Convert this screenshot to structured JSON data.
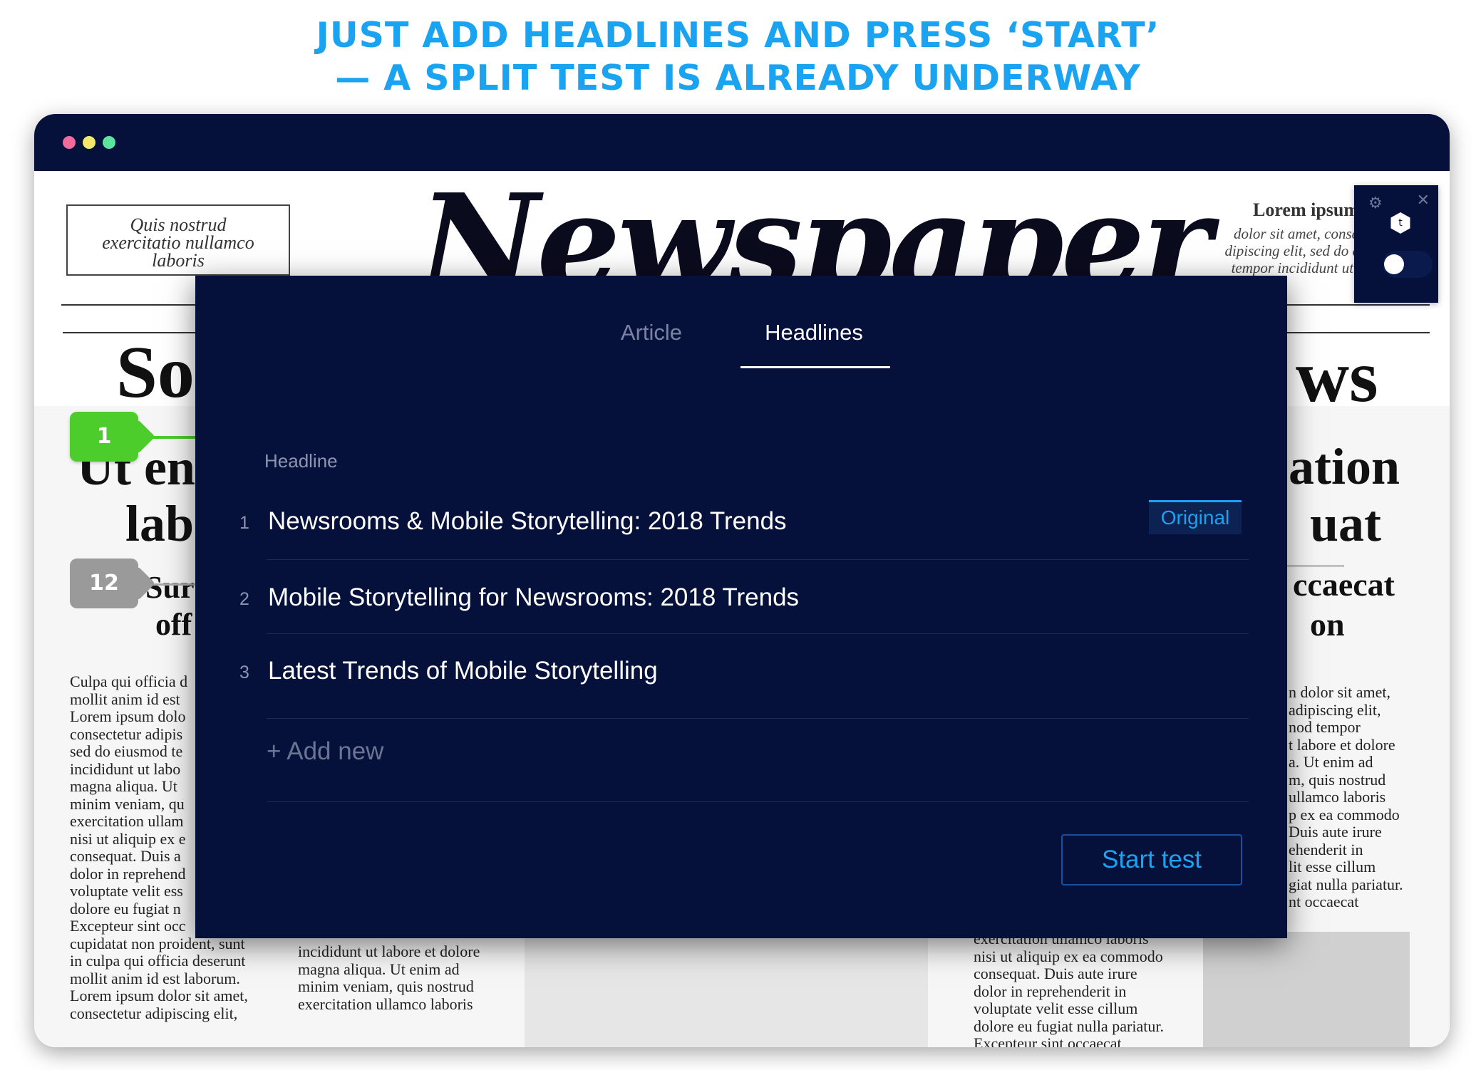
{
  "promo": {
    "line1": "JUST ADD HEADLINES AND PRESS ‘START’",
    "line2": "— A SPLIT TEST IS ALREADY UNDERWAY"
  },
  "window": {
    "controls": [
      "close",
      "minimize",
      "maximize"
    ]
  },
  "newspaper": {
    "masthead": "Newspaper",
    "ear_left": [
      "Quis nostrud",
      "exercitatio nullamco",
      "laboris"
    ],
    "ear_right_title": "Lorem ipsum",
    "ear_right_body": [
      "dolor sit amet, consectetur",
      "dipiscing elit, sed do eiusmod",
      "tempor incididunt ut labore"
    ],
    "headline_left_1": "So",
    "headline_right_1": "ws",
    "sub_left_1": "Ut en",
    "sub_left_2": "lab",
    "sub_right_1": "ation",
    "sub_right_2": "uat",
    "small_left_1": "Sur",
    "small_left_2": "off",
    "small_right_1": "ccaecat",
    "small_right_2": "on",
    "col_left": [
      "Culpa qui officia d",
      "mollit anim id est",
      "Lorem ipsum dolo",
      "consectetur adipis",
      "sed do eiusmod te",
      "incididunt ut labo",
      "magna aliqua. Ut",
      "minim veniam, qu",
      "exercitation ullam",
      "nisi ut aliquip ex e",
      "consequat. Duis a",
      "dolor in reprehend",
      "voluptate velit ess",
      "dolore eu fugiat n",
      "Excepteur sint occ",
      "cupidatat non proident, sunt",
      "in culpa qui officia deserunt",
      "mollit anim id est laborum.",
      "Lorem ipsum dolor sit amet,",
      "consectetur adipiscing elit,"
    ],
    "col_mid": [
      "incididunt ut labore et dolore",
      "magna aliqua. Ut enim ad",
      "minim veniam, quis nostrud",
      "exercitation ullamco laboris"
    ],
    "col_right": [
      "n dolor sit amet,",
      "adipiscing elit,",
      "nod tempor",
      "t labore et dolore",
      "a. Ut enim ad",
      "m, quis nostrud",
      "ullamco laboris",
      "p ex ea commodo",
      "Duis aute irure",
      "ehenderit in",
      "lit esse cillum",
      "giat nulla pariatur.",
      "nt occaecat"
    ],
    "col_right2": [
      "exercitation ullamco laboris",
      "nisi ut aliquip ex ea commodo",
      "consequat. Duis aute irure",
      "dolor in reprehenderit in",
      "voluptate velit esse cillum",
      "dolore eu fugiat nulla pariatur.",
      "Excepteur sint occaecat"
    ]
  },
  "markers": [
    {
      "label": "1",
      "color": "#4ccd2c"
    },
    {
      "label": "12",
      "color": "#9a9a9a"
    }
  ],
  "widget": {
    "gear_icon": "⚙",
    "close_icon": "✕",
    "hex_label": "t"
  },
  "panel": {
    "tabs": [
      {
        "label": "Article",
        "active": false
      },
      {
        "label": "Headlines",
        "active": true
      }
    ],
    "column_label": "Headline",
    "headlines": [
      {
        "num": "1",
        "text": "Newsrooms & Mobile Storytelling: 2018 Trends",
        "badge": "Original"
      },
      {
        "num": "2",
        "text": "Mobile Storytelling for Newsrooms: 2018 Trends"
      },
      {
        "num": "3",
        "text": "Latest Trends of Mobile Storytelling"
      }
    ],
    "add_new": "+ Add new",
    "start_button": "Start test"
  },
  "colors": {
    "accent": "#1aa3f0",
    "panel_bg": "#05113a",
    "marker_green": "#4ccd2c",
    "marker_gray": "#9a9a9a"
  }
}
